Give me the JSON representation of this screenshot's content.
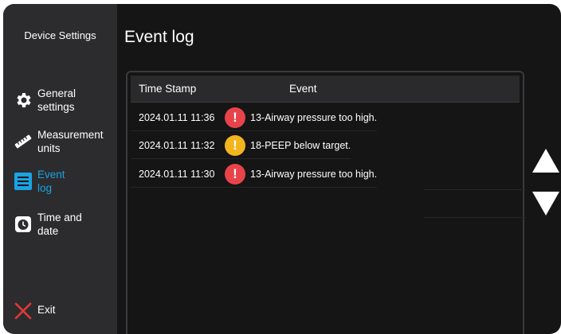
{
  "sidebar": {
    "title": "Device Settings",
    "items": [
      {
        "line1": "General",
        "line2": "settings",
        "icon": "gear-icon",
        "active": false
      },
      {
        "line1": "Measurement",
        "line2": "units",
        "icon": "ruler-icon",
        "active": false
      },
      {
        "line1": "Event",
        "line2": "log",
        "icon": "list-icon",
        "active": true
      },
      {
        "line1": "Time and",
        "line2": "date",
        "icon": "clock-icon",
        "active": false
      }
    ],
    "exit_label": "Exit"
  },
  "main": {
    "title": "Event log",
    "table": {
      "columns": [
        "Time Stamp",
        "Event"
      ],
      "rows": [
        {
          "timestamp": "2024.01.11 11:36",
          "severity": "high",
          "event": "13-Airway pressure too high."
        },
        {
          "timestamp": "2024.01.11 11:32",
          "severity": "medium",
          "event": "18-PEEP below target."
        },
        {
          "timestamp": "2024.01.11 11:30",
          "severity": "high",
          "event": "13-Airway pressure too high."
        }
      ]
    }
  },
  "colors": {
    "accent": "#1aa3e3",
    "alarm_high": "#e8434b",
    "alarm_medium": "#f2b51e",
    "exit_red": "#e53935"
  }
}
